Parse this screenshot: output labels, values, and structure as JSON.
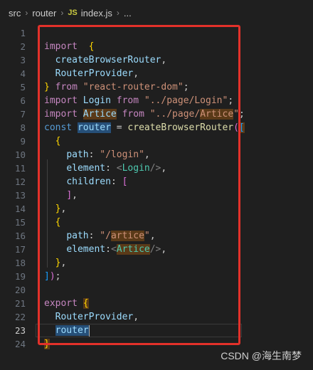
{
  "breadcrumb": {
    "folder1": "src",
    "folder2": "router",
    "file_icon": "JS",
    "file": "index.js",
    "ellipsis": "..."
  },
  "lines": [
    {
      "n": "1",
      "tokens": []
    },
    {
      "n": "2",
      "tokens": [
        [
          "kw2",
          "import"
        ],
        [
          "",
          "  "
        ],
        [
          "br",
          "{"
        ]
      ]
    },
    {
      "n": "3",
      "tokens": [
        [
          "",
          "  "
        ],
        [
          "var",
          "createBrowserRouter"
        ],
        [
          "",
          ","
        ]
      ]
    },
    {
      "n": "4",
      "tokens": [
        [
          "",
          "  "
        ],
        [
          "var",
          "RouterProvider"
        ],
        [
          "",
          ","
        ]
      ]
    },
    {
      "n": "5",
      "tokens": [
        [
          "br",
          "}"
        ],
        [
          "",
          " "
        ],
        [
          "kw2",
          "from"
        ],
        [
          "",
          " "
        ],
        [
          "str",
          "\"react-router-dom\""
        ],
        [
          "",
          ";"
        ]
      ]
    },
    {
      "n": "6",
      "tokens": [
        [
          "kw2",
          "import"
        ],
        [
          "",
          " "
        ],
        [
          "var",
          "Login"
        ],
        [
          "",
          " "
        ],
        [
          "kw2",
          "from"
        ],
        [
          "",
          " "
        ],
        [
          "str",
          "\"../page/Login\""
        ],
        [
          "",
          ";"
        ]
      ]
    },
    {
      "n": "7",
      "tokens": [
        [
          "kw2",
          "import"
        ],
        [
          "",
          " "
        ],
        [
          "var hl-word",
          "Artice"
        ],
        [
          "",
          " "
        ],
        [
          "kw2",
          "from"
        ],
        [
          "",
          " "
        ],
        [
          "str",
          "\"../page/"
        ],
        [
          "str hl-word",
          "Artice"
        ],
        [
          "str",
          "\""
        ],
        [
          "",
          ";"
        ]
      ]
    },
    {
      "n": "8",
      "tokens": [
        [
          "kw",
          "const"
        ],
        [
          "",
          " "
        ],
        [
          "var hl-sel",
          "router"
        ],
        [
          "",
          " = "
        ],
        [
          "fn",
          "createBrowserRouter"
        ],
        [
          "br2",
          "("
        ],
        [
          "br3 hl-word",
          "["
        ]
      ]
    },
    {
      "n": "9",
      "tokens": [
        [
          "",
          "  "
        ],
        [
          "br",
          "{"
        ]
      ]
    },
    {
      "n": "10",
      "tokens": [
        [
          "",
          "    "
        ],
        [
          "var",
          "path"
        ],
        [
          "",
          ": "
        ],
        [
          "str",
          "\"/login\""
        ],
        [
          "",
          ","
        ]
      ]
    },
    {
      "n": "11",
      "tokens": [
        [
          "",
          "    "
        ],
        [
          "var",
          "element"
        ],
        [
          "",
          ": "
        ],
        [
          "punc",
          "<"
        ],
        [
          "tag",
          "Login"
        ],
        [
          "punc",
          "/>"
        ],
        [
          "",
          ","
        ]
      ]
    },
    {
      "n": "12",
      "tokens": [
        [
          "",
          "    "
        ],
        [
          "var",
          "children"
        ],
        [
          "",
          ": "
        ],
        [
          "br2",
          "["
        ]
      ]
    },
    {
      "n": "13",
      "tokens": [
        [
          "",
          "    "
        ],
        [
          "br2",
          "]"
        ],
        [
          "",
          ","
        ]
      ]
    },
    {
      "n": "14",
      "tokens": [
        [
          "",
          "  "
        ],
        [
          "br",
          "}"
        ],
        [
          "",
          ","
        ]
      ]
    },
    {
      "n": "15",
      "tokens": [
        [
          "",
          "  "
        ],
        [
          "br",
          "{"
        ]
      ]
    },
    {
      "n": "16",
      "tokens": [
        [
          "",
          "    "
        ],
        [
          "var",
          "path"
        ],
        [
          "",
          ": "
        ],
        [
          "str",
          "\"/"
        ],
        [
          "str hl-word",
          "artice"
        ],
        [
          "str",
          "\""
        ],
        [
          "",
          ","
        ]
      ]
    },
    {
      "n": "17",
      "tokens": [
        [
          "",
          "    "
        ],
        [
          "var",
          "element"
        ],
        [
          "",
          ":"
        ],
        [
          "punc",
          "<"
        ],
        [
          "tag hl-word",
          "Artice"
        ],
        [
          "punc",
          "/>"
        ],
        [
          "",
          ","
        ]
      ]
    },
    {
      "n": "18",
      "tokens": [
        [
          "",
          "  "
        ],
        [
          "br",
          "}"
        ],
        [
          "",
          ","
        ]
      ]
    },
    {
      "n": "19",
      "tokens": [
        [
          "br3",
          "]"
        ],
        [
          "br2",
          ")"
        ],
        [
          "",
          ";"
        ]
      ]
    },
    {
      "n": "20",
      "tokens": []
    },
    {
      "n": "21",
      "tokens": [
        [
          "kw2",
          "export"
        ],
        [
          "",
          " "
        ],
        [
          "br hl-word",
          "{"
        ]
      ]
    },
    {
      "n": "22",
      "tokens": [
        [
          "",
          "  "
        ],
        [
          "var",
          "RouterProvider"
        ],
        [
          "",
          ","
        ]
      ]
    },
    {
      "n": "23",
      "tokens": [
        [
          "",
          "  "
        ],
        [
          "var hl-sel",
          "router"
        ]
      ]
    },
    {
      "n": "24",
      "tokens": [
        [
          "br hl-word",
          "}"
        ]
      ]
    }
  ],
  "active_line": "23",
  "watermark": "CSDN @海生南梦",
  "colors": {
    "background": "#1f1f1f",
    "annotation_frame": "#e3312a",
    "keyword": "#569cd6",
    "import_keyword": "#c586c0",
    "string": "#ce9178",
    "variable": "#9cdcfe",
    "function": "#dcdcaa",
    "jsx_tag": "#4ec9b0"
  }
}
